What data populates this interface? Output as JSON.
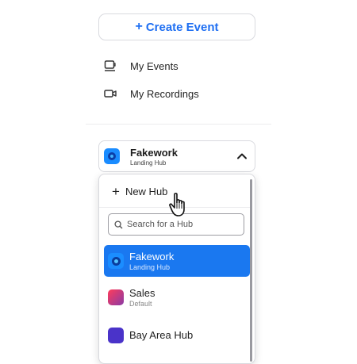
{
  "create_event": {
    "label": "Create Event",
    "plus": "+"
  },
  "nav": {
    "my_events": {
      "label": "My Events",
      "icon": "calendar-cup-icon"
    },
    "my_recordings": {
      "label": "My Recordings",
      "icon": "video-camera-icon"
    }
  },
  "hub_selector": {
    "name": "Fakework",
    "subtitle": "Landing Hub",
    "chevron": "chevron-up-icon"
  },
  "dropdown": {
    "new_hub_label": "New Hub",
    "new_hub_plus": "+",
    "search_placeholder": "Search for a Hub",
    "hubs": [
      {
        "name": "Fakework",
        "subtitle": "Landing Hub",
        "selected": true,
        "color": "#1b8dff"
      },
      {
        "name": "Sales",
        "subtitle": "Default",
        "selected": false,
        "color": "#e03c6c"
      },
      {
        "name": "Bay Area Hub",
        "subtitle": "",
        "selected": false,
        "color": "#4a33c9"
      }
    ]
  },
  "colors": {
    "accent": "#1a78f0",
    "link": "#1f6ff2"
  }
}
